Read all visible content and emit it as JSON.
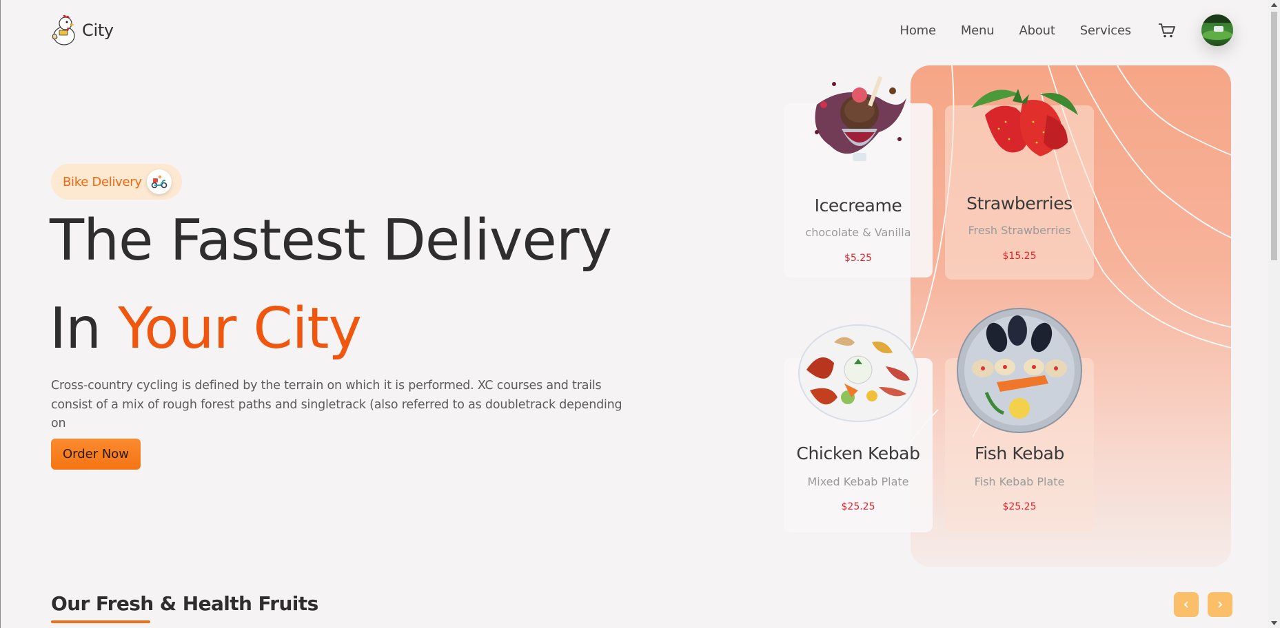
{
  "header": {
    "brand_name": "City",
    "nav": [
      "Home",
      "Menu",
      "About",
      "Services"
    ]
  },
  "hero": {
    "badge_label": "Bike Delivery",
    "title_line1": "The Fastest Delivery",
    "title_line2_prefix": "In",
    "title_line2_accent": "Your City",
    "description": "Cross-country cycling is defined by the terrain on which it is performed. XC courses and trails consist of a mix of rough forest paths and singletrack (also referred to as doubletrack depending on",
    "cta_label": "Order Now"
  },
  "cards": [
    {
      "name": "Icecreame",
      "subtitle": "chocolate & Vanilla",
      "price": "$5.25"
    },
    {
      "name": "Strawberries",
      "subtitle": "Fresh Strawberries",
      "price": "$15.25"
    },
    {
      "name": "Chicken Kebab",
      "subtitle": "Mixed Kebab Plate",
      "price": "$25.25"
    },
    {
      "name": "Fish Kebab",
      "subtitle": "Fish Kebab Plate",
      "price": "$25.25"
    }
  ],
  "section": {
    "title": "Our Fresh & Health Fruits"
  },
  "colors": {
    "accent": "#f0560e",
    "button": "#f57514",
    "price": "#e0242b",
    "arrow": "#fbbf6a"
  }
}
